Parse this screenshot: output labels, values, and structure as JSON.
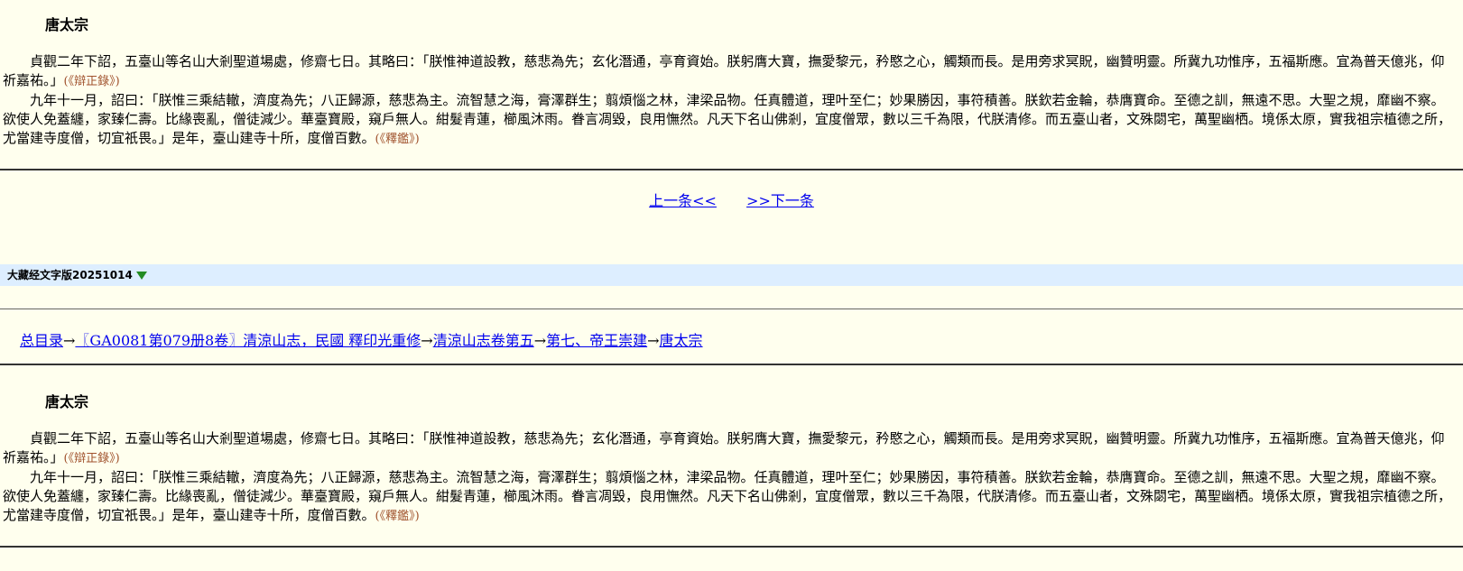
{
  "section1": {
    "title": "唐太宗",
    "para1": "貞觀二年下詔，五臺山等名山大剎聖道場處，修齋七日。其略曰：「朕惟神道設教，慈悲為先；玄化潛通，亭育資始。朕躬膺大寶，撫愛黎元，矜愍之心，觸類而長。是用旁求冥貺，幽贊明靈。所冀九功惟序，五福斯應。宜為普天億兆，仰祈嘉祐。」",
    "para1_source": "(《辯正錄》)",
    "para2": "九年十一月，詔曰：「朕惟三乘結轍，濟度為先；八正歸源，慈悲為主。流智慧之海，膏澤群生；翦煩惱之林，津梁品物。任真體道，理叶至仁；妙果勝因，事符積善。朕欽若金輪，恭膺寶命。至德之訓，無遠不思。大聖之規，靡幽不察。欲使人免蓋纏，家臻仁壽。比緣喪亂，僧徒減少。華臺寶殿，窺戶無人。紺髮青蓮，櫛風沐雨。眷言凋毀，良用憮然。凡天下名山佛剎，宜度僧眾，數以三千為限，代朕清修。而五臺山者，文殊閟宅，萬聖幽栖。境係太原，實我祖宗植德之所，尤當建寺度僧，切宜祇畏。」是年，臺山建寺十所，度僧百數。",
    "para2_source": "(《釋鑑》)"
  },
  "nav": {
    "prev": "上一条<<",
    "next": ">>下一条"
  },
  "version": {
    "label": "大藏经文字版20251014"
  },
  "breadcrumb": {
    "items": [
      "总目录",
      "〖GA0081第079册8卷〗清涼山志，民國 釋印光重修",
      "清涼山志卷第五",
      "第七、帝王崇建",
      "唐太宗"
    ],
    "separator": "→"
  },
  "section2": {
    "title": "唐太宗",
    "para1": "貞觀二年下詔，五臺山等名山大剎聖道場處，修齋七日。其略曰：「朕惟神道設教，慈悲為先；玄化潛通，亭育資始。朕躬膺大寶，撫愛黎元，矜愍之心，觸類而長。是用旁求冥貺，幽贊明靈。所冀九功惟序，五福斯應。宜為普天億兆，仰祈嘉祐。」",
    "para1_source": "(《辯正錄》)",
    "para2": "九年十一月，詔曰：「朕惟三乘結轍，濟度為先；八正歸源，慈悲為主。流智慧之海，膏澤群生；翦煩惱之林，津梁品物。任真體道，理叶至仁；妙果勝因，事符積善。朕欽若金輪，恭膺寶命。至德之訓，無遠不思。大聖之規，靡幽不察。欲使人免蓋纏，家臻仁壽。比緣喪亂，僧徒減少。華臺寶殿，窺戶無人。紺髮青蓮，櫛風沐雨。眷言凋毀，良用憮然。凡天下名山佛剎，宜度僧眾，數以三千為限，代朕清修。而五臺山者，文殊閟宅，萬聖幽栖。境係太原，實我祖宗植德之所，尤當建寺度僧，切宜祇畏。」是年，臺山建寺十所，度僧百數。",
    "para2_source": "(《釋鑑》)"
  },
  "colors": {
    "background": "#FFFFEE",
    "link": "#0000EE",
    "source": "#A0522D",
    "version_bar": "#DDEEFF",
    "triangle": "#228B22"
  },
  "icons": {
    "version_toggle": "triangle-down-icon"
  }
}
